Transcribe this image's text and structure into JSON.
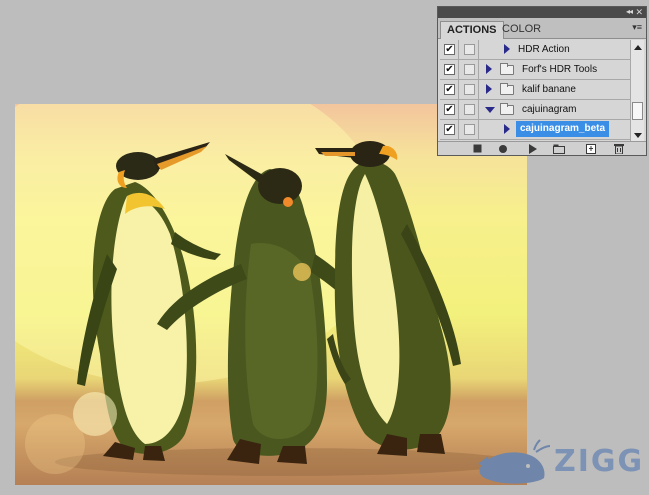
{
  "panel": {
    "collapse_icon": "double-chevron-right-icon",
    "close_icon": "close-icon",
    "menu_icon": "panel-menu-icon",
    "tabs": [
      {
        "label": "ACTIONS",
        "active": true
      },
      {
        "label": "COLOR",
        "active": false
      }
    ],
    "actions": [
      {
        "label": "HDR Action",
        "checked": true,
        "type": "action",
        "expanded": false,
        "selected": false
      },
      {
        "label": "Forf's HDR Tools",
        "checked": true,
        "type": "set",
        "expanded": false,
        "selected": false
      },
      {
        "label": "kalif banane",
        "checked": true,
        "type": "set",
        "expanded": false,
        "selected": false
      },
      {
        "label": "cajuinagram",
        "checked": true,
        "type": "set",
        "expanded": true,
        "selected": false
      },
      {
        "label": "cajuinagram_beta",
        "checked": true,
        "type": "action",
        "expanded": false,
        "selected": true
      }
    ],
    "check_glyph": "✔",
    "footer_buttons": [
      "stop-icon",
      "record-icon",
      "play-icon",
      "new-set-icon",
      "new-action-icon",
      "trash-icon"
    ],
    "selection_color": "#3a8ee6"
  },
  "photo": {
    "subject": "penguins",
    "tint_color": "#f3f17d"
  },
  "watermark": {
    "text": "ZIGG",
    "icon": "whale-icon",
    "color": "#7d93b5"
  }
}
